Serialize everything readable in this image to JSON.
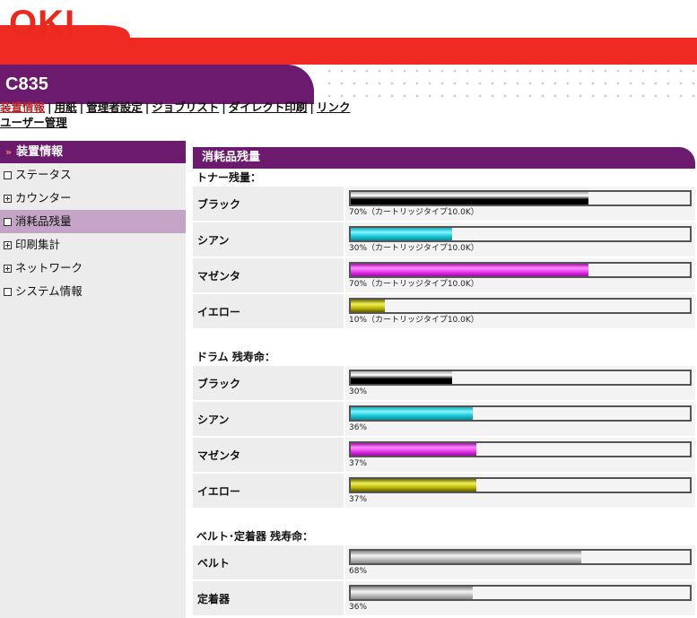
{
  "brand": {
    "logo_text": "OKI",
    "model": "C835",
    "primary_color": "#6b1a6d",
    "accent_red": "#e8291c"
  },
  "nav": {
    "items": [
      "装置情報",
      "用紙",
      "管理者設定",
      "ジョブリスト",
      "ダイレクト印刷",
      "リンク"
    ],
    "second_row": "ユーザー管理",
    "separator": "|"
  },
  "sidebar": {
    "header": "装置情報",
    "header_icon": "double-chevron-down-icon",
    "items": [
      {
        "label": "ステータス",
        "icon": "square-icon"
      },
      {
        "label": "カウンター",
        "icon": "plus-box-icon"
      },
      {
        "label": "消耗品残量",
        "icon": "square-icon",
        "active": true
      },
      {
        "label": "印刷集計",
        "icon": "plus-box-icon"
      },
      {
        "label": "ネットワーク",
        "icon": "plus-box-icon"
      },
      {
        "label": "システム情報",
        "icon": "square-icon"
      }
    ]
  },
  "main": {
    "title": "消耗品残量",
    "toner": {
      "title": "トナー残量：",
      "rows": [
        {
          "label": "ブラック",
          "percent": 70,
          "text": "70%（カートリッジタイプ10.0K）",
          "color": "black"
        },
        {
          "label": "シアン",
          "percent": 30,
          "text": "30%（カートリッジタイプ10.0K）",
          "color": "cyan"
        },
        {
          "label": "マゼンタ",
          "percent": 70,
          "text": "70%（カートリッジタイプ10.0K）",
          "color": "magenta"
        },
        {
          "label": "イエロー",
          "percent": 10,
          "text": "10%（カートリッジタイプ10.0K）",
          "color": "yellow"
        }
      ]
    },
    "drum": {
      "title": "ドラム 残寿命：",
      "rows": [
        {
          "label": "ブラック",
          "percent": 30,
          "text": "30%",
          "color": "black"
        },
        {
          "label": "シアン",
          "percent": 36,
          "text": "36%",
          "color": "cyan"
        },
        {
          "label": "マゼンタ",
          "percent": 37,
          "text": "37%",
          "color": "magenta"
        },
        {
          "label": "イエロー",
          "percent": 37,
          "text": "37%",
          "color": "yellow"
        }
      ]
    },
    "belt_fuser": {
      "title": "ベルト･定着器 残寿命：",
      "rows": [
        {
          "label": "ベルト",
          "percent": 68,
          "text": "68%",
          "color": "gray"
        },
        {
          "label": "定着器",
          "percent": 36,
          "text": "36%",
          "color": "gray"
        }
      ]
    }
  }
}
